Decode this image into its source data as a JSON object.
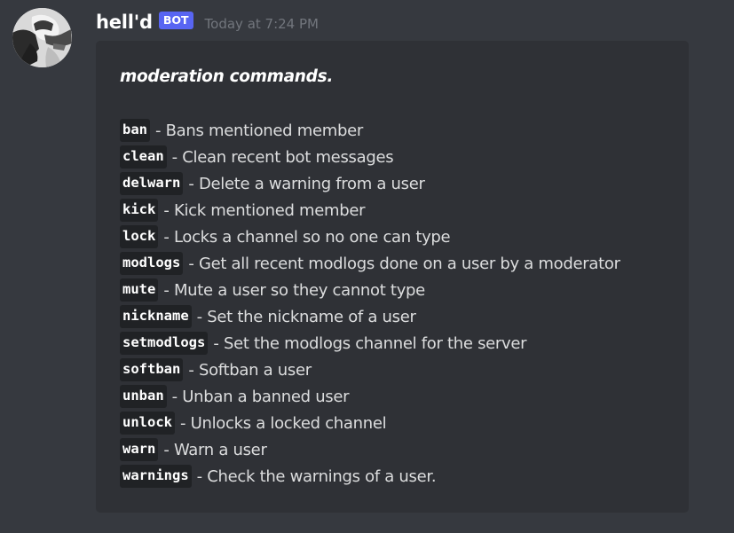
{
  "message": {
    "username": "hell'd",
    "bot_tag": "BOT",
    "timestamp": "Today at 7:24 PM",
    "avatar_icon": "anime-character-avatar"
  },
  "embed": {
    "title": "moderation commands.",
    "commands": [
      {
        "name": "ban",
        "description": "- Bans mentioned member"
      },
      {
        "name": "clean",
        "description": "- Clean recent bot messages"
      },
      {
        "name": "delwarn",
        "description": "- Delete a warning from a user"
      },
      {
        "name": "kick",
        "description": "- Kick mentioned member"
      },
      {
        "name": "lock",
        "description": "- Locks a channel so no one can type"
      },
      {
        "name": "modlogs",
        "description": "- Get all recent modlogs done on a user by a moderator"
      },
      {
        "name": "mute",
        "description": "- Mute a user so they cannot type"
      },
      {
        "name": "nickname",
        "description": "- Set the nickname of a user"
      },
      {
        "name": "setmodlogs",
        "description": "- Set the modlogs channel for the server"
      },
      {
        "name": "softban",
        "description": "- Softban a user"
      },
      {
        "name": "unban",
        "description": "- Unban a banned user"
      },
      {
        "name": "unlock",
        "description": "- Unlocks a locked channel"
      },
      {
        "name": "warn",
        "description": "- Warn a user"
      },
      {
        "name": "warnings",
        "description": "- Check the warnings of a user."
      }
    ]
  },
  "colors": {
    "background": "#36393f",
    "embed_background": "#2f3136",
    "bot_tag": "#5865f2",
    "timestamp": "#72767d",
    "code_background": "#202225"
  }
}
